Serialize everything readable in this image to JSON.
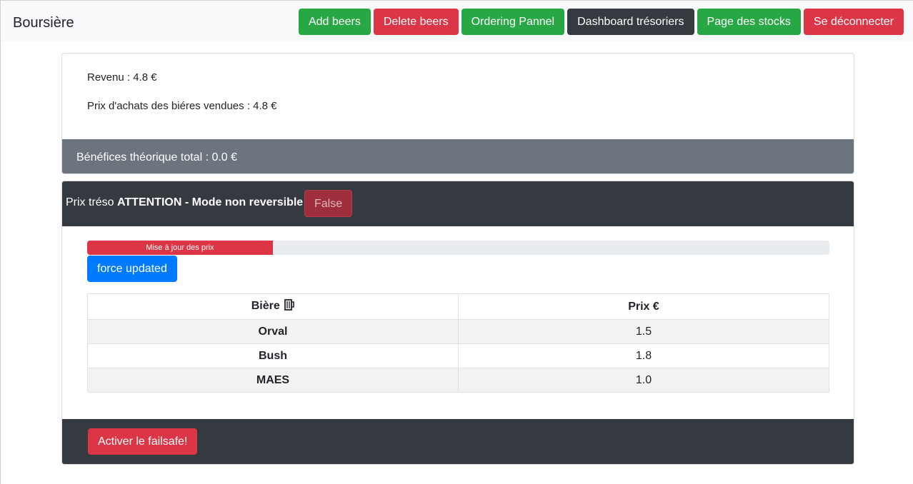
{
  "navbar": {
    "brand": "Boursière",
    "buttons": [
      {
        "label": "Add beers",
        "style": "success"
      },
      {
        "label": "Delete beers",
        "style": "danger"
      },
      {
        "label": "Ordering Pannel",
        "style": "success"
      },
      {
        "label": "Dashboard trésoriers",
        "style": "dark"
      },
      {
        "label": "Page des stocks",
        "style": "success"
      },
      {
        "label": "Se déconnecter",
        "style": "danger"
      }
    ]
  },
  "summary": {
    "revenue": "Revenu : 4.8 €",
    "purchase_cost": "Prix d'achats des biéres vendues : 4.8 €",
    "profit": "Bénéfices théorique total : 0.0 €"
  },
  "treso": {
    "header_prefix": "Prix tréso",
    "header_warning": "ATTENTION - Mode non reversible",
    "toggle_label": "False",
    "progress_label": "Mise à jour des prix",
    "progress_fraction": 0.25,
    "force_button": "force updated",
    "failsafe_button": "Activer le failsafe!"
  },
  "table": {
    "headers": [
      "Bière",
      "Prix €"
    ],
    "header_icon": "beer-mug-icon",
    "rows": [
      {
        "name": "Orval",
        "price": "1.5"
      },
      {
        "name": "Bush",
        "price": "1.8"
      },
      {
        "name": "MAES",
        "price": "1.0"
      }
    ]
  },
  "colors": {
    "success": "#28a745",
    "danger": "#dc3545",
    "dark": "#343a40",
    "primary": "#007bff",
    "secondary": "#6c757d"
  }
}
